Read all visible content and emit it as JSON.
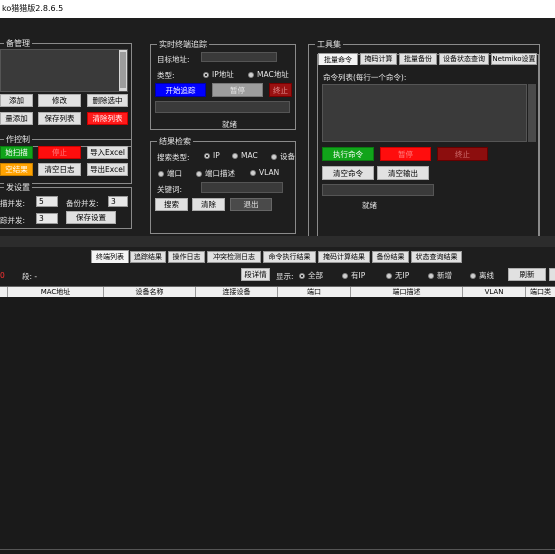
{
  "titlebar": {
    "title": "ko猎猎版2.8.6.5"
  },
  "device_mgmt": {
    "title": "备管理",
    "buttons": {
      "add": "添加",
      "edit": "修改",
      "delete_sel": "删除选中",
      "batch_add": "量添加",
      "save_list": "保存列表",
      "clear_list": "清除列表"
    }
  },
  "op_control": {
    "title": "作控制",
    "buttons": {
      "start_scan": "始扫描",
      "stop": "停止",
      "import_excel": "导入Excel",
      "clear_results": "空结果",
      "clear_log": "清空日志",
      "export_excel": "导出Excel"
    }
  },
  "concurrency": {
    "title": "发设置",
    "scan_label": "描并发:",
    "scan_value": "5",
    "backup_label": "备份并发:",
    "backup_value": "3",
    "search_label": "踪并发:",
    "search_value": "3",
    "save_btn": "保存设置"
  },
  "trace": {
    "title": "实时终端追踪",
    "target_label": "目标地址:",
    "type_label": "类型:",
    "type_ip": "IP地址",
    "type_mac": "MAC地址",
    "start_btn": "开始追踪",
    "pause_btn": "暂停",
    "stop_btn": "终止",
    "status": "就绪"
  },
  "search": {
    "title": "结果检索",
    "type_label": "搜索类型:",
    "opt_ip": "IP",
    "opt_mac": "MAC",
    "opt_dev": "设备",
    "opt_port": "端口",
    "opt_desc": "端口描述",
    "opt_vlan": "VLAN",
    "keyword_label": "关键词:",
    "search_btn": "搜索",
    "clear_btn": "清除",
    "exit_btn": "退出"
  },
  "toolbox": {
    "title": "工具集",
    "tabs": [
      "批量命令",
      "掩码计算",
      "批量备份",
      "设备状态查询",
      "Netmiko设置"
    ],
    "cmd_list_label": "命令列表(每行一个命令):",
    "exec_btn": "执行命令",
    "pause_btn": "暂停",
    "stop_btn": "终止",
    "clear_cmd_btn": "清空命令",
    "clear_output_btn": "清空输出",
    "status": "就绪"
  },
  "result_tabs": [
    "终端列表",
    "追踪结果",
    "操作日志",
    "冲突检测日志",
    "命令执行结果",
    "掩码计算结果",
    "备份结果",
    "状态查询结果"
  ],
  "filter_bar": {
    "count_prefix": "0",
    "segment_label": "段: -",
    "segment_detail_btn": "段详情",
    "display_label": "显示:",
    "options": [
      "全部",
      "有IP",
      "无IP",
      "新增",
      "离线"
    ],
    "refresh_btn": "刷新",
    "extra_btn": ""
  },
  "table": {
    "columns": [
      "",
      "MAC地址",
      "设备名称",
      "连接设备",
      "端口",
      "端口描述",
      "VLAN",
      "端口类"
    ]
  }
}
